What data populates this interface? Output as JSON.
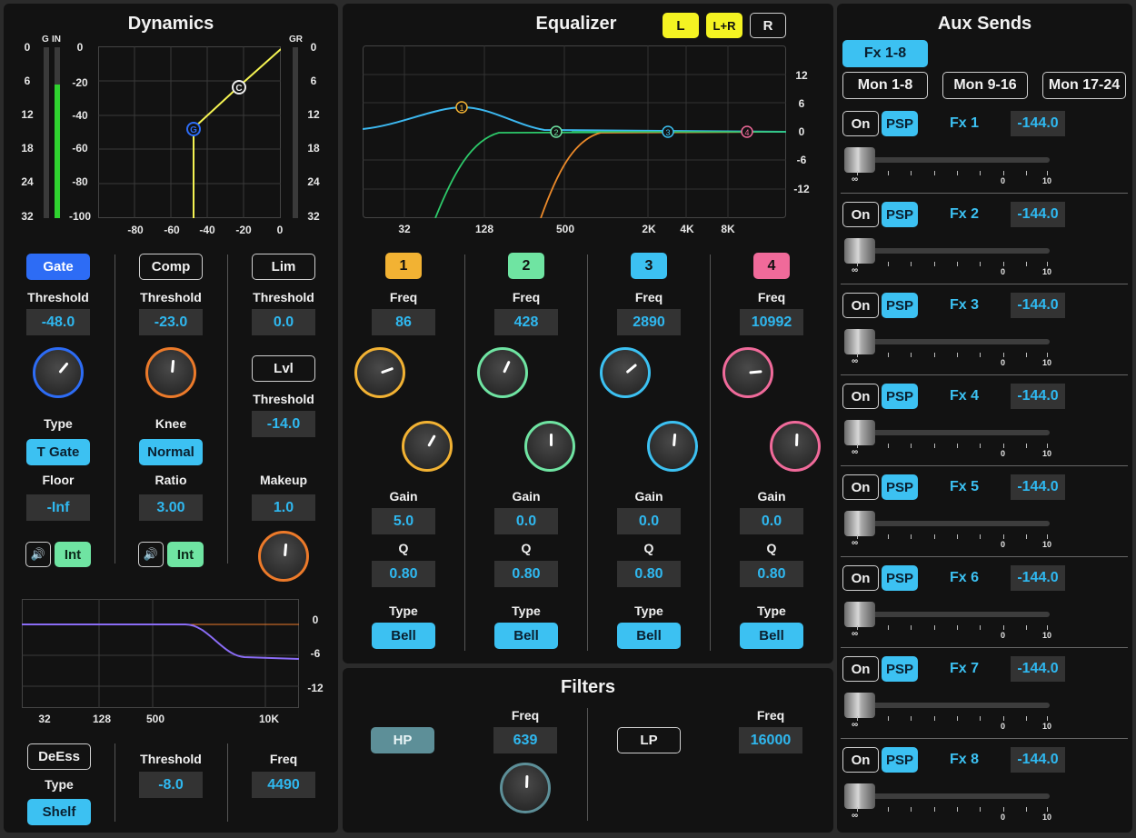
{
  "colors": {
    "accent": "#3cc1f2",
    "value_text": "#2fb8f0",
    "panel": "#121212",
    "band1": "#f2b233",
    "band2": "#6fe4a2",
    "band3": "#3cc1f2",
    "band4": "#f06a9a",
    "gate_blue": "#2d6cf5",
    "comp_orange": "#ec7a2a",
    "meter_green": "#2fd22f"
  },
  "dynamics": {
    "title": "Dynamics",
    "meter_labels": {
      "g": "G",
      "in": "IN",
      "gr": "GR"
    },
    "left_scale": [
      "0",
      "6",
      "12",
      "18",
      "24",
      "32"
    ],
    "right_scale": [
      "0",
      "6",
      "12",
      "18",
      "24",
      "32"
    ],
    "in_level": 0.78,
    "graph_y": [
      "0",
      "-20",
      "-40",
      "-60",
      "-80",
      "-100"
    ],
    "graph_x": [
      "-80",
      "-60",
      "-40",
      "-20",
      "0"
    ],
    "point_g": "G",
    "point_c": "C",
    "gate": {
      "label": "Gate",
      "threshold_label": "Threshold",
      "threshold": "-48.0",
      "type_label": "Type",
      "type": "T Gate",
      "floor_label": "Floor",
      "floor": "-Inf",
      "int": "Int"
    },
    "comp": {
      "label": "Comp",
      "threshold_label": "Threshold",
      "threshold": "-23.0",
      "knee_label": "Knee",
      "knee": "Normal",
      "ratio_label": "Ratio",
      "ratio": "3.00",
      "int": "Int"
    },
    "lim": {
      "label": "Lim",
      "threshold_label": "Threshold",
      "threshold": "0.0",
      "lvl_label": "Lvl",
      "lvl_threshold_label": "Threshold",
      "lvl_threshold": "-14.0",
      "makeup_label": "Makeup",
      "makeup": "1.0"
    },
    "deess_graph": {
      "y": [
        "0",
        "-6",
        "-12"
      ],
      "x": [
        "32",
        "128",
        "500",
        "10K"
      ]
    },
    "deess": {
      "label": "DeEss",
      "type_label": "Type",
      "type": "Shelf",
      "threshold_label": "Threshold",
      "threshold": "-8.0",
      "freq_label": "Freq",
      "freq": "4490"
    }
  },
  "equalizer": {
    "title": "Equalizer",
    "channels": [
      "L",
      "L+R",
      "R"
    ],
    "graph_y": [
      "12",
      "6",
      "0",
      "-6",
      "-12"
    ],
    "graph_x": [
      "32",
      "128",
      "500",
      "2K",
      "4K",
      "8K"
    ],
    "bands": [
      {
        "num": "1",
        "freq_label": "Freq",
        "freq": "86",
        "gain_label": "Gain",
        "gain": "5.0",
        "q_label": "Q",
        "q": "0.80",
        "type_label": "Type",
        "type": "Bell"
      },
      {
        "num": "2",
        "freq_label": "Freq",
        "freq": "428",
        "gain_label": "Gain",
        "gain": "0.0",
        "q_label": "Q",
        "q": "0.80",
        "type_label": "Type",
        "type": "Bell"
      },
      {
        "num": "3",
        "freq_label": "Freq",
        "freq": "2890",
        "gain_label": "Gain",
        "gain": "0.0",
        "q_label": "Q",
        "q": "0.80",
        "type_label": "Type",
        "type": "Bell"
      },
      {
        "num": "4",
        "freq_label": "Freq",
        "freq": "10992",
        "gain_label": "Gain",
        "gain": "0.0",
        "q_label": "Q",
        "q": "0.80",
        "type_label": "Type",
        "type": "Bell"
      }
    ]
  },
  "filters": {
    "title": "Filters",
    "hp": "HP",
    "hp_freq_label": "Freq",
    "hp_freq": "639",
    "lp": "LP",
    "lp_freq_label": "Freq",
    "lp_freq": "16000"
  },
  "aux": {
    "title": "Aux Sends",
    "groups": [
      "Fx 1-8",
      "Mon 1-8",
      "Mon 9-16",
      "Mon 17-24"
    ],
    "scale": [
      "∞",
      "0",
      "10"
    ],
    "sends": [
      {
        "on": "On",
        "psp": "PSP",
        "name": "Fx 1",
        "level": "-144.0"
      },
      {
        "on": "On",
        "psp": "PSP",
        "name": "Fx 2",
        "level": "-144.0"
      },
      {
        "on": "On",
        "psp": "PSP",
        "name": "Fx 3",
        "level": "-144.0"
      },
      {
        "on": "On",
        "psp": "PSP",
        "name": "Fx 4",
        "level": "-144.0"
      },
      {
        "on": "On",
        "psp": "PSP",
        "name": "Fx 5",
        "level": "-144.0"
      },
      {
        "on": "On",
        "psp": "PSP",
        "name": "Fx 6",
        "level": "-144.0"
      },
      {
        "on": "On",
        "psp": "PSP",
        "name": "Fx 7",
        "level": "-144.0"
      },
      {
        "on": "On",
        "psp": "PSP",
        "name": "Fx 8",
        "level": "-144.0"
      }
    ]
  }
}
